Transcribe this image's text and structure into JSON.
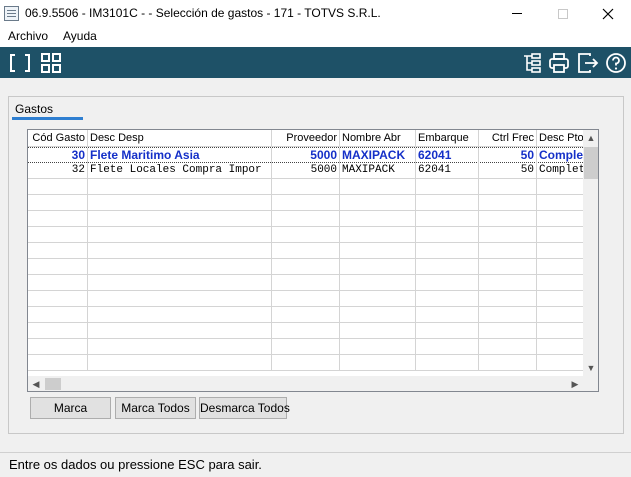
{
  "window": {
    "title": "06.9.5506 - IM3101C -  - Selección de gastos - 171 - TOTVS S.R.L.",
    "minimize": "–",
    "maximize": "□",
    "close": "✕"
  },
  "menu": {
    "items": [
      "Archivo",
      "Ayuda"
    ]
  },
  "toolbar": {
    "left_icons": [
      "brackets-icon",
      "grid-icon"
    ],
    "right_icons": [
      "tree-icon",
      "print-icon",
      "exit-icon",
      "help-icon"
    ],
    "brand_color": "#1e5167"
  },
  "tab": {
    "label": "Gastos",
    "accent": "#2f7fd1"
  },
  "table": {
    "columns": [
      "Cód Gasto",
      "Desc Desp",
      "Proveedor",
      "Nombre Abr",
      "Embarque",
      "Ctrl Frec",
      "Desc Pto"
    ],
    "rows": [
      [
        "30",
        "Flete Maritimo Asia",
        "5000",
        "MAXIPACK",
        "62041",
        "50",
        "Complet"
      ],
      [
        "32",
        "Flete Locales Compra Impor",
        "5000",
        "MAXIPACK",
        "62041",
        "50",
        "Complet"
      ]
    ],
    "selected_row": 0,
    "selected_color": "#1530c8"
  },
  "buttons": {
    "marca": "Marca",
    "marca_todos": "Marca Todos",
    "desmarca_todos": "Desmarca Todos"
  },
  "status": {
    "text": "Entre os dados ou pressione ESC para sair."
  }
}
